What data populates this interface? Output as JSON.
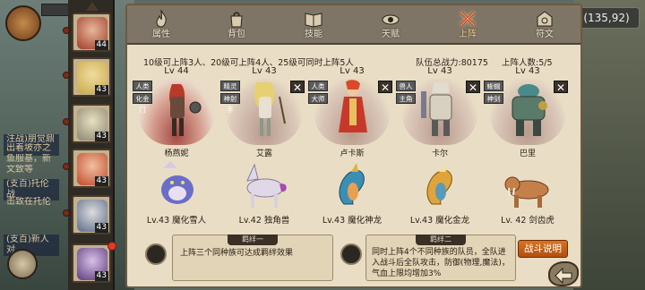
{
  "coords": "(135,92)",
  "log_lines": [
    "注战)朋觉鼎",
    "出着坡亦之",
    "鱼服基，新",
    "文致等",
    "(支百)托伦战",
    "击致在托伦",
    "(支百)新人对"
  ],
  "tabs": [
    {
      "label": "属性",
      "icon": "flame-icon",
      "active": false
    },
    {
      "label": "背包",
      "icon": "bag-icon",
      "active": false
    },
    {
      "label": "技能",
      "icon": "book-icon",
      "active": false
    },
    {
      "label": "天赋",
      "icon": "eye-icon",
      "active": false
    },
    {
      "label": "上阵",
      "icon": "swords-icon",
      "active": true
    },
    {
      "label": "符文",
      "icon": "rune-icon",
      "active": false
    }
  ],
  "info": {
    "rule": "10级可上阵3人、20级可上阵4人、25级可同时上阵5人",
    "power": "队伍总战力:80175",
    "count": "上阵人数:5/5"
  },
  "heroes": [
    {
      "level": "Lv 44",
      "name": "杨燕妮",
      "tags": [
        "人类",
        "化金门"
      ],
      "color": "#9b3a2a"
    },
    {
      "level": "Lv 43",
      "name": "艾露",
      "tags": [
        "精灵",
        "神射手"
      ],
      "color": "#d9c35a"
    },
    {
      "level": "Lv 43",
      "name": "卢卡斯",
      "tags": [
        "人类",
        "大师"
      ],
      "color": "#c0382a"
    },
    {
      "level": "Lv 43",
      "name": "卡尔",
      "tags": [
        "兽人",
        "主角"
      ],
      "color": "#dcd6c6"
    },
    {
      "level": "Lv 43",
      "name": "巴里",
      "tags": [
        "蜥蜴人",
        "神剑"
      ],
      "color": "#5d8a8a"
    }
  ],
  "pets": [
    {
      "label": "Lv.43 魔化雪人",
      "color": "#6a6ec9"
    },
    {
      "label": "Lv.42 独角兽",
      "color": "#e0d8e6"
    },
    {
      "label": "Lv.43 魔化神龙",
      "color": "#3b8fb5"
    },
    {
      "label": "Lv.43 魔化金龙",
      "color": "#e0a53a"
    },
    {
      "label": "Lv. 42 剑齿虎",
      "color": "#c5804a"
    }
  ],
  "roster_levels": [
    "44",
    "43",
    "43",
    "43",
    "43",
    "43"
  ],
  "bonds": [
    {
      "title": "羁绊一",
      "desc": "上阵三个同种族可达成羁绊效果"
    },
    {
      "title": "羁绊二",
      "desc": "同时上阵4个不同种族的队员，全队进入战斗后全队攻击，防御(物理,魔法)，气血上限均增加3%"
    }
  ],
  "battle_button": "战斗说明"
}
